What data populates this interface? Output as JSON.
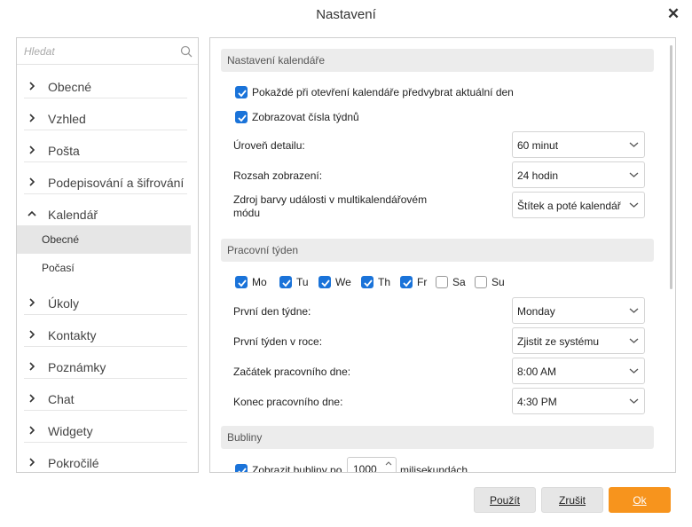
{
  "window": {
    "title": "Nastavení"
  },
  "sidebar": {
    "search_placeholder": "Hledat",
    "items": [
      {
        "label": "Obecné",
        "expanded": false
      },
      {
        "label": "Vzhled",
        "expanded": false
      },
      {
        "label": "Pošta",
        "expanded": false
      },
      {
        "label": "Podepisování a šifrování",
        "expanded": false
      },
      {
        "label": "Kalendář",
        "expanded": true
      },
      {
        "label": "Úkoly",
        "expanded": false
      },
      {
        "label": "Kontakty",
        "expanded": false
      },
      {
        "label": "Poznámky",
        "expanded": false
      },
      {
        "label": "Chat",
        "expanded": false
      },
      {
        "label": "Widgety",
        "expanded": false
      },
      {
        "label": "Pokročilé",
        "expanded": false
      }
    ],
    "subitems": [
      {
        "label": "Obecné",
        "active": true
      },
      {
        "label": "Počasí",
        "active": false
      }
    ]
  },
  "calendar_settings": {
    "header": "Nastavení kalendáře",
    "preselect_today": {
      "label": "Pokaždé při otevření kalendáře předvybrat aktuální den",
      "checked": true
    },
    "show_week_numbers": {
      "label": "Zobrazovat čísla týdnů",
      "checked": true
    },
    "detail_level": {
      "label": "Úroveň detailu:",
      "value": "60 minut"
    },
    "display_range": {
      "label": "Rozsah zobrazení:",
      "value": "24 hodin"
    },
    "color_source": {
      "label_line1": "Zdroj barvy události v multikalendářovém",
      "label_line2": "módu",
      "value": "Štítek a poté kalendář"
    }
  },
  "work_week": {
    "header": "Pracovní týden",
    "days": [
      {
        "label": "Mo",
        "checked": true
      },
      {
        "label": "Tu",
        "checked": true
      },
      {
        "label": "We",
        "checked": true
      },
      {
        "label": "Th",
        "checked": true
      },
      {
        "label": "Fr",
        "checked": true
      },
      {
        "label": "Sa",
        "checked": false
      },
      {
        "label": "Su",
        "checked": false
      }
    ],
    "first_day": {
      "label": "První den týdne:",
      "value": "Monday"
    },
    "first_week": {
      "label": "První týden v roce:",
      "value": "Zjistit ze systému"
    },
    "day_start": {
      "label": "Začátek pracovního dne:",
      "value": "8:00 AM"
    },
    "day_end": {
      "label": "Konec pracovního dne:",
      "value": "4:30 PM"
    }
  },
  "bubbles": {
    "header": "Bubliny",
    "show_bubbles": {
      "label_before": "Zobrazit bubliny po",
      "value": "1000",
      "label_after": "milisekundách",
      "checked": true
    }
  },
  "footer": {
    "apply": "Použít",
    "cancel": "Zrušit",
    "ok": "Ok"
  },
  "colors": {
    "accent": "#1a73d9",
    "ok_button": "#f7941d"
  }
}
